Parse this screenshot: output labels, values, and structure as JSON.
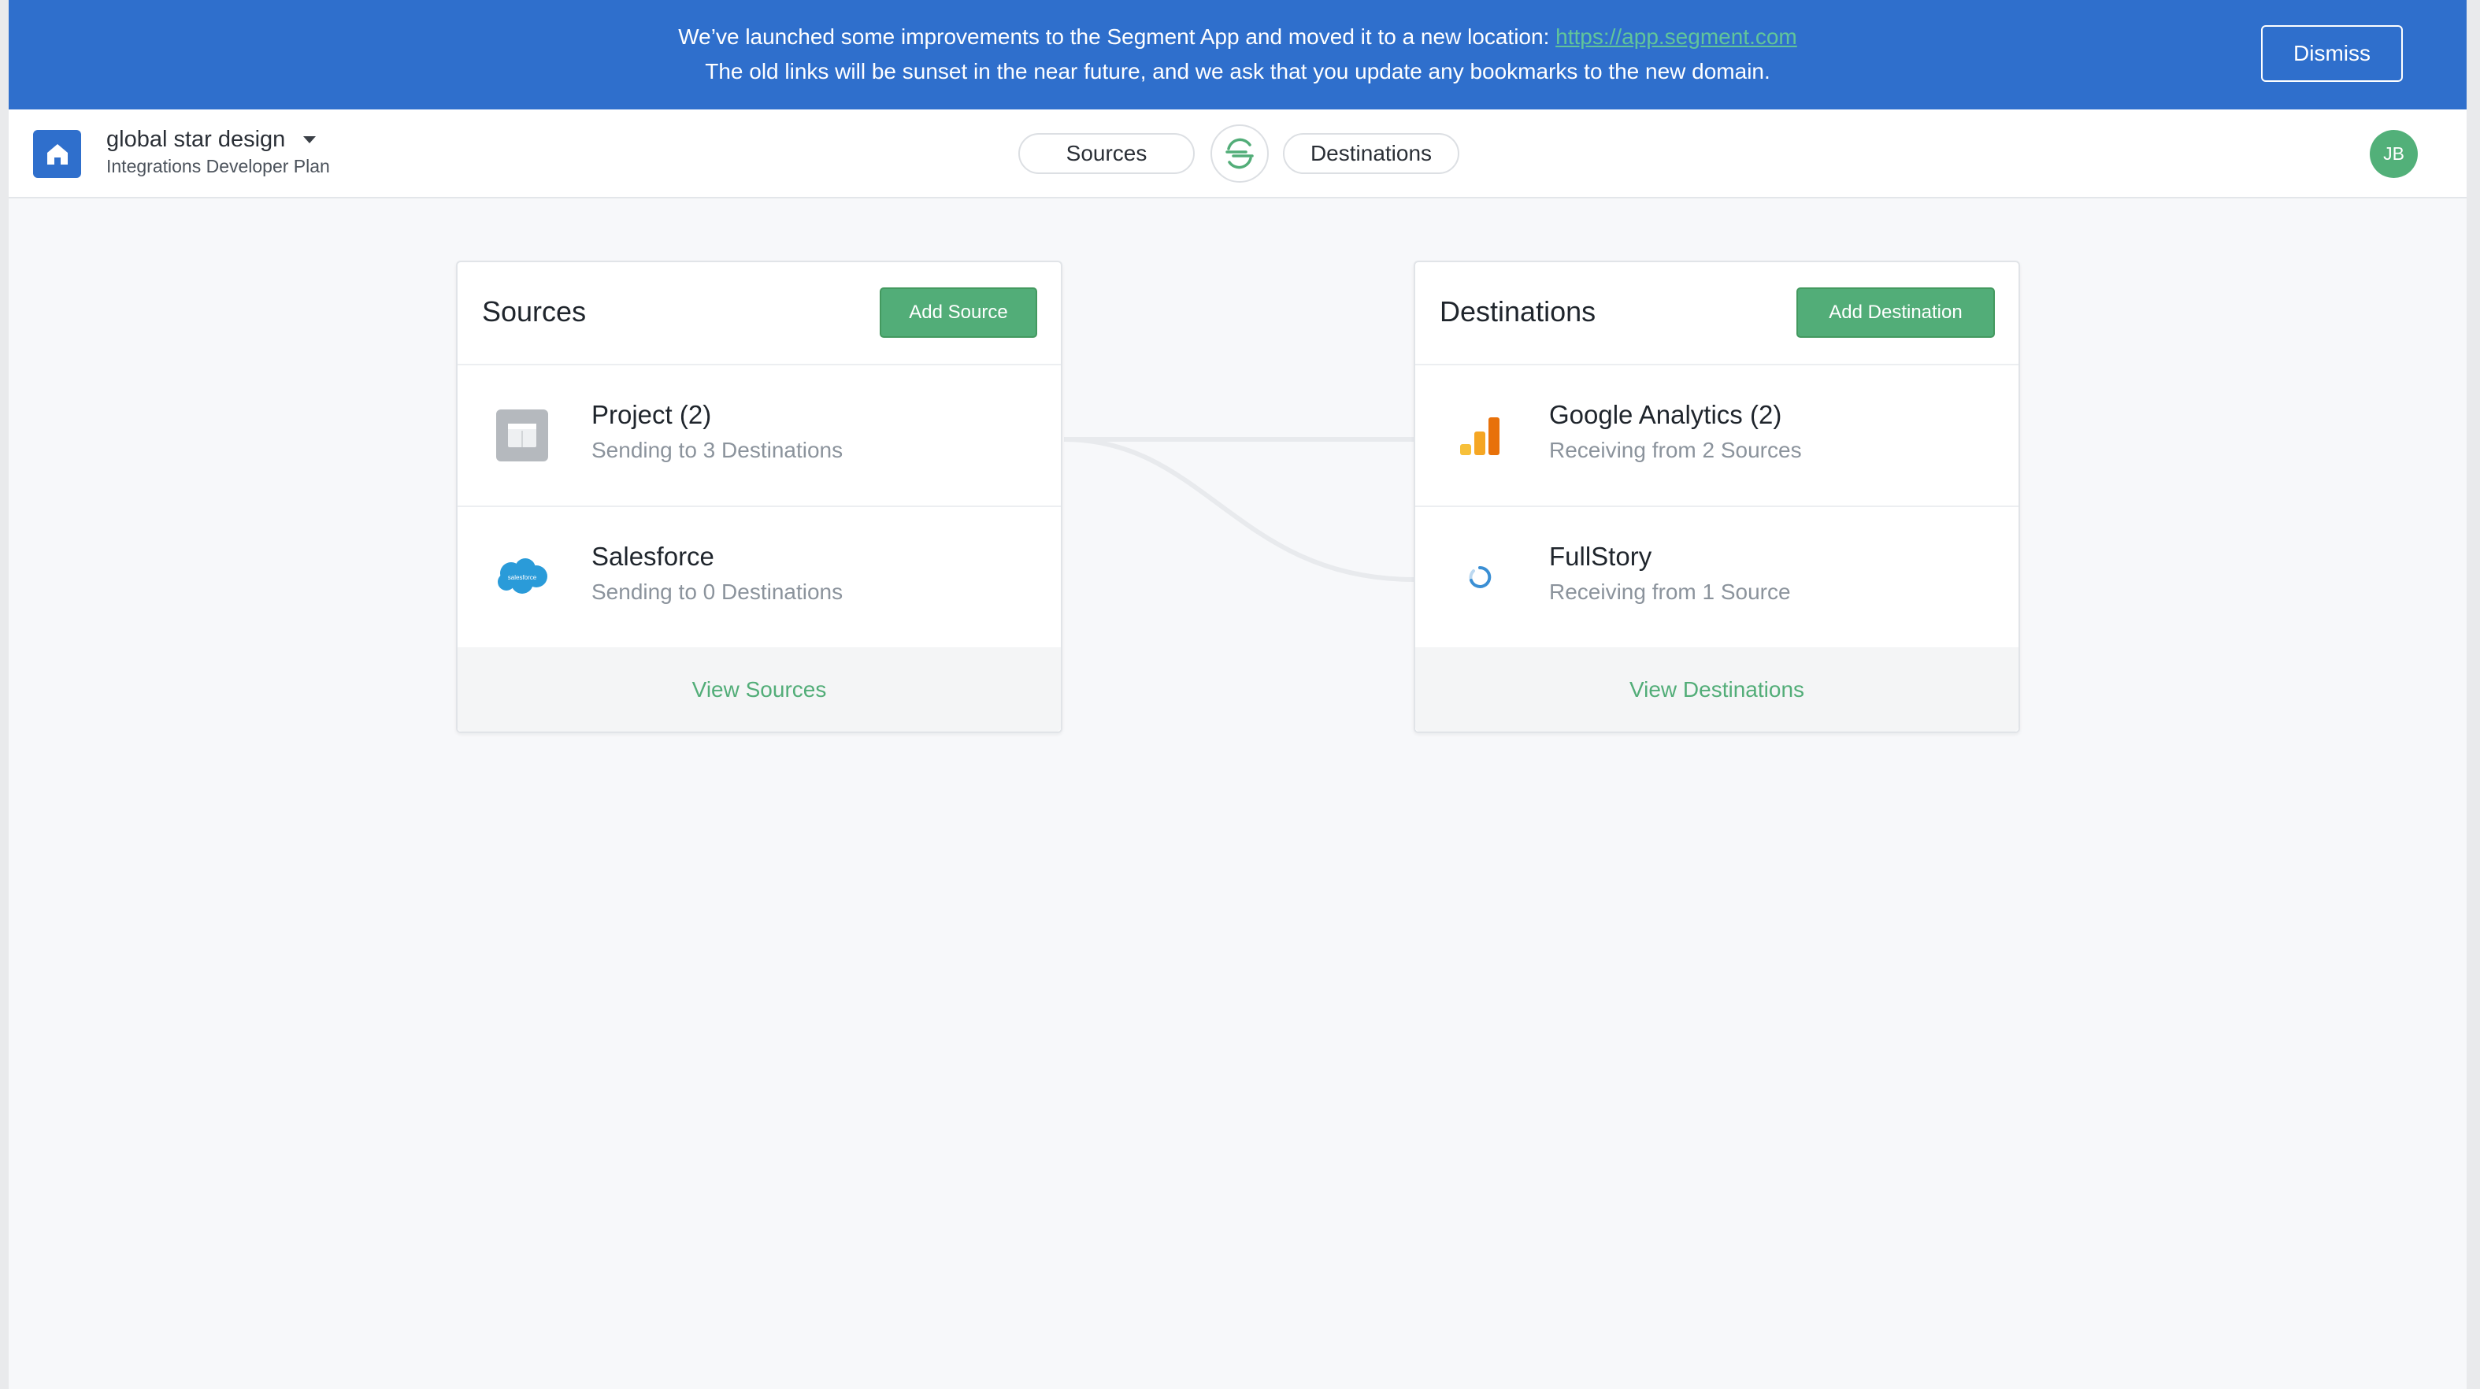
{
  "banner": {
    "line1_prefix": "We’ve launched some improvements to the Segment App and moved it to a new location: ",
    "link": "https://app.segment.com",
    "line2": "The old links will be sunset in the near future, and we ask that you update any bookmarks to the new domain.",
    "dismiss_label": "Dismiss",
    "background_color": "#2f6fcc"
  },
  "topnav": {
    "workspace_name": "global star design",
    "plan": "Integrations Developer Plan",
    "sources_label": "Sources",
    "destinations_label": "Destinations",
    "avatar_initials": "JB"
  },
  "sources": {
    "title": "Sources",
    "add_label": "Add Source",
    "items": [
      {
        "name": "Project (2)",
        "subtitle": "Sending to 3 Destinations",
        "icon": "project-icon"
      },
      {
        "name": "Salesforce",
        "subtitle": "Sending to 0 Destinations",
        "icon": "salesforce-icon",
        "icon_text": "salesforce"
      }
    ],
    "footer_label": "View Sources"
  },
  "destinations": {
    "title": "Destinations",
    "add_label": "Add Destination",
    "items": [
      {
        "name": "Google Analytics (2)",
        "subtitle": "Receiving from 2 Sources",
        "icon": "google-analytics-icon"
      },
      {
        "name": "FullStory",
        "subtitle": "Receiving from 1 Source",
        "icon": "fullstory-icon"
      }
    ],
    "footer_label": "View Destinations"
  },
  "colors": {
    "accent_green": "#52ad78",
    "brand_blue": "#2f6fcc",
    "avatar_green": "#52b079"
  }
}
